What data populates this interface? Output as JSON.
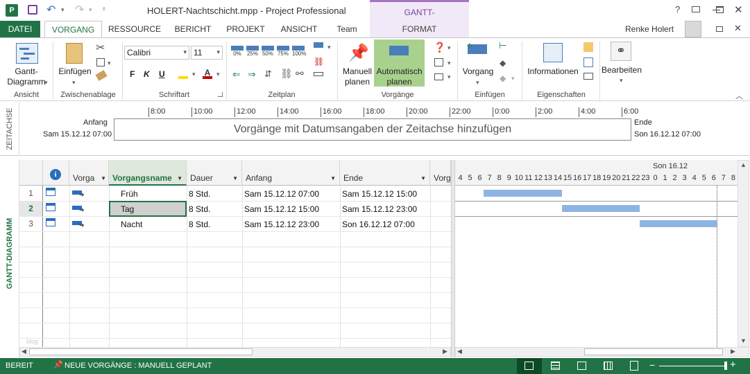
{
  "app": {
    "title": "HOLERT-Nachtschicht.mpp - Project Professional",
    "tool_context": "GANTT-DIAGRAMMTOOLS",
    "user": "Renke Holert",
    "help": "?"
  },
  "tabs": [
    {
      "label": "DATEI"
    },
    {
      "label": "VORGANG"
    },
    {
      "label": "RESSOURCE"
    },
    {
      "label": "BERICHT"
    },
    {
      "label": "PROJEKT"
    },
    {
      "label": "ANSICHT"
    },
    {
      "label": "Team"
    },
    {
      "label": "FORMAT"
    }
  ],
  "ribbon": {
    "groups": {
      "ansicht": "Ansicht",
      "zwischenablage": "Zwischenablage",
      "schriftart": "Schriftart",
      "zeitplan": "Zeitplan",
      "vorgaenge": "Vorgänge",
      "einfuegen": "Einfügen",
      "eigenschaften": "Eigenschaften"
    },
    "gantt_button": "Gantt-\nDiagramm",
    "paste_button": "Einfügen",
    "font_name": "Calibri",
    "font_size": "11",
    "bold": "F",
    "italic": "K",
    "underline": "U",
    "percent_labels": [
      "0%",
      "25%",
      "50%",
      "75%",
      "100%"
    ],
    "manual_button": "Manuell\nplanen",
    "auto_button": "Automatisch\nplanen",
    "task_button": "Vorgang",
    "info_button": "Informationen",
    "edit_button": "Bearbeiten"
  },
  "timeline": {
    "side_label": "ZEITACHSE",
    "start_label": "Anfang",
    "start_value": "Sam 15.12.12 07:00",
    "end_label": "Ende",
    "end_value": "Son 16.12.12 07:00",
    "placeholder": "Vorgänge mit Datumsangaben der Zeitachse hinzufügen",
    "ticks": [
      "8:00",
      "10:00",
      "12:00",
      "14:00",
      "16:00",
      "18:00",
      "20:00",
      "22:00",
      "0:00",
      "2:00",
      "4:00",
      "6:00"
    ]
  },
  "gantt": {
    "side_label": "GANTT-DIAGRAMM",
    "columns": {
      "mode": "Vorga",
      "name": "Vorgangsname",
      "duration": "Dauer",
      "start": "Anfang",
      "end": "Ende",
      "pred": "Vorg"
    },
    "rows": [
      {
        "num": "1",
        "name": "Früh",
        "duration": "8 Std.",
        "start": "Sam 15.12.12 07:00",
        "end": "Sam 15.12.12 15:00"
      },
      {
        "num": "2",
        "name": "Tag",
        "duration": "8 Std.",
        "start": "Sam 15.12.12 15:00",
        "end": "Sam 15.12.12 23:00"
      },
      {
        "num": "3",
        "name": "Nacht",
        "duration": "8 Std.",
        "start": "Sam 15.12.12 23:00",
        "end": "Son 16.12.12 07:00"
      }
    ],
    "chart_day_label": "Son 16.12",
    "chart_hours": [
      "4",
      "5",
      "6",
      "7",
      "8",
      "9",
      "10",
      "11",
      "12",
      "13",
      "14",
      "15",
      "16",
      "17",
      "18",
      "19",
      "20",
      "21",
      "22",
      "23",
      "0",
      "1",
      "2",
      "3",
      "4",
      "5",
      "6",
      "7",
      "8"
    ],
    "blog_watermark": "blog"
  },
  "status": {
    "ready": "BEREIT",
    "mode": "NEUE VORGÄNGE : MANUELL GEPLANT"
  },
  "colors": {
    "accent": "#217346",
    "tool_tab": "#a675c6",
    "bar": "#8db4e2"
  }
}
